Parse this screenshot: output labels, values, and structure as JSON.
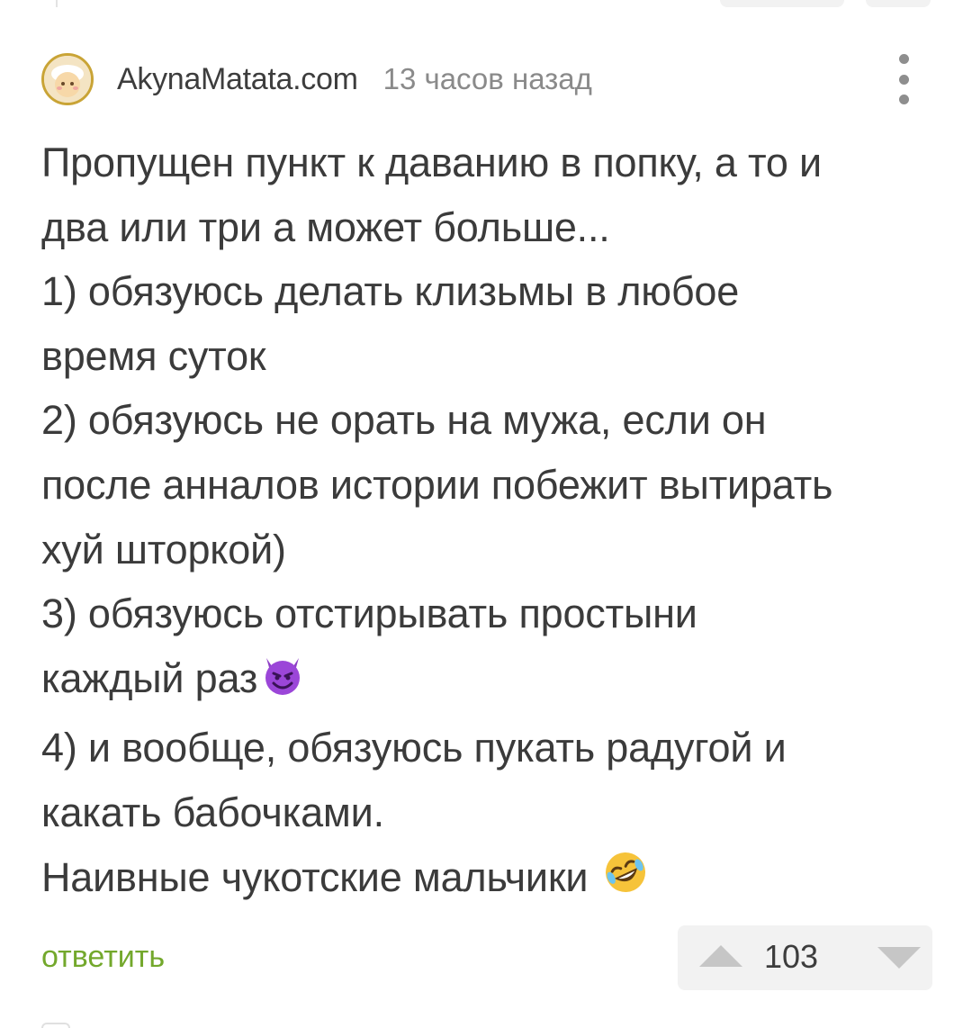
{
  "comment": {
    "author": "AkynaMatata.com",
    "time": "13 часов назад",
    "lines": [
      "Пропущен пункт к даванию в попку, а то и",
      "два или три а может больше...",
      "1) обязуюсь делать клизьмы в любое",
      "время суток",
      "2) обязуюсь не орать на мужа, если он",
      "после анналов истории побежит вытирать",
      "хуй шторкой)",
      "3) обязуюсь отстирывать простыни",
      "каждый раз",
      "4) и вообще, обязуюсь пукать радугой и",
      "какать бабочками.",
      "Наивные чукотские мальчики"
    ],
    "reply_label": "ответить",
    "rating": "103",
    "icons": {
      "avatar": "avatar-image",
      "more": "more-vertical-icon",
      "devil": "smiling-devil-emoji",
      "rofl": "rolling-laughing-emoji",
      "upvote": "triangle-up-icon",
      "downvote": "triangle-down-icon"
    },
    "colors": {
      "reply": "#73a82c",
      "text": "#3b3b3b",
      "meta": "#8a8a8a"
    }
  }
}
